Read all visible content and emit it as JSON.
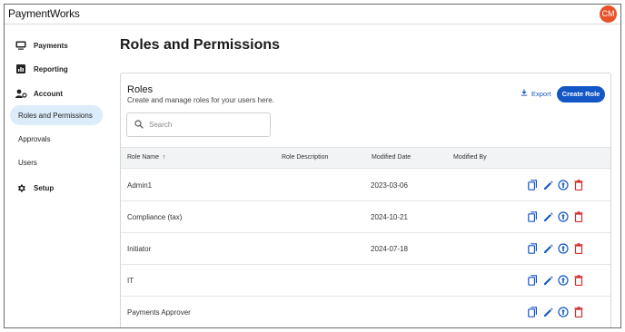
{
  "app": {
    "logo_text": "PaymentWorks",
    "avatar_initials": "CM"
  },
  "colors": {
    "accent": "#1356c6",
    "avatar": "#e8522b",
    "active_nav_bg": "#dcecfb",
    "delete": "#d32f2f"
  },
  "sidebar": {
    "items": [
      {
        "label": "Payments",
        "icon": "payments-icon"
      },
      {
        "label": "Reporting",
        "icon": "reporting-icon"
      },
      {
        "label": "Account",
        "icon": "account-icon"
      }
    ],
    "account_subitems": [
      {
        "label": "Roles and Permissions",
        "active": true
      },
      {
        "label": "Approvals",
        "active": false
      },
      {
        "label": "Users",
        "active": false
      }
    ],
    "setup": {
      "label": "Setup",
      "icon": "gear-icon"
    }
  },
  "main": {
    "title": "Roles and Permissions",
    "card": {
      "title": "Roles",
      "subtitle": "Create and manage roles for your users here.",
      "export_label": "Export",
      "create_label": "Create Role",
      "search_placeholder": "Search"
    },
    "table": {
      "columns": [
        "Role Name",
        "Role Description",
        "Modified Date",
        "Modified By"
      ],
      "sort_indicator": "↑",
      "rows": [
        {
          "name": "Admin1",
          "description": "",
          "modified_date": "2023-03-06",
          "modified_by": ""
        },
        {
          "name": "Compliance (tax)",
          "description": "",
          "modified_date": "2024-10-21",
          "modified_by": ""
        },
        {
          "name": "Initiator",
          "description": "",
          "modified_date": "2024-07-18",
          "modified_by": ""
        },
        {
          "name": "IT",
          "description": "",
          "modified_date": "",
          "modified_by": ""
        },
        {
          "name": "Payments Approver",
          "description": "",
          "modified_date": "",
          "modified_by": ""
        }
      ],
      "row_actions": [
        "copy-icon",
        "edit-icon",
        "info-icon",
        "delete-icon"
      ]
    }
  }
}
